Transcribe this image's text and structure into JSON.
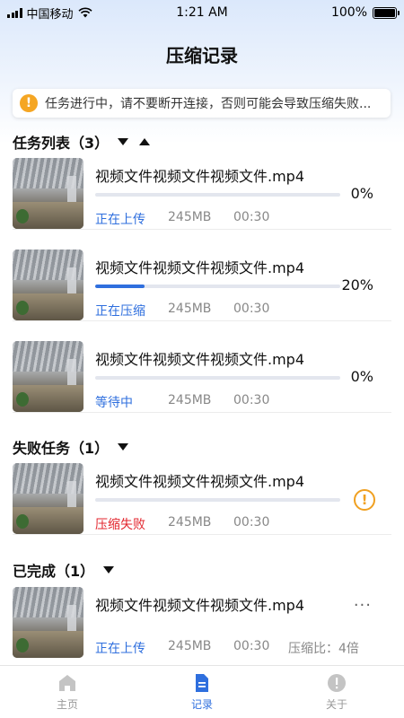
{
  "status_bar": {
    "carrier": "中国移动",
    "time": "1:21 AM",
    "battery": "100%"
  },
  "page_title": "压缩记录",
  "warning": "任务进行中，请不要断开连接，否则可能会导致压缩失败...",
  "task_section": {
    "title": "任务列表（3）",
    "items": [
      {
        "name": "视频文件视频文件视频文件.mp4",
        "progress": 0,
        "percent": "0%",
        "status": "正在上传",
        "size": "245MB",
        "duration": "00:30"
      },
      {
        "name": "视频文件视频文件视频文件.mp4",
        "progress": 0.2,
        "percent": "20%",
        "status": "正在压缩",
        "size": "245MB",
        "duration": "00:30"
      },
      {
        "name": "视频文件视频文件视频文件.mp4",
        "progress": 0,
        "percent": "0%",
        "status": "等待中",
        "size": "245MB",
        "duration": "00:30"
      }
    ]
  },
  "failed_section": {
    "title": "失败任务（1）",
    "items": [
      {
        "name": "视频文件视频文件视频文件.mp4",
        "progress": 0,
        "status": "压缩失败",
        "size": "245MB",
        "duration": "00:30",
        "icon": "alert-icon"
      }
    ]
  },
  "done_section": {
    "title": "已完成（1）",
    "items": [
      {
        "name": "视频文件视频文件视频文件.mp4",
        "status": "正在上传",
        "size": "245MB",
        "duration": "00:30",
        "ratio": "压缩比：4倍"
      }
    ]
  },
  "tabbar": {
    "home": "主页",
    "records": "记录",
    "about": "关于"
  },
  "colors": {
    "accent": "#2f6fde",
    "error": "#e3262e",
    "warning": "#f5a623"
  }
}
